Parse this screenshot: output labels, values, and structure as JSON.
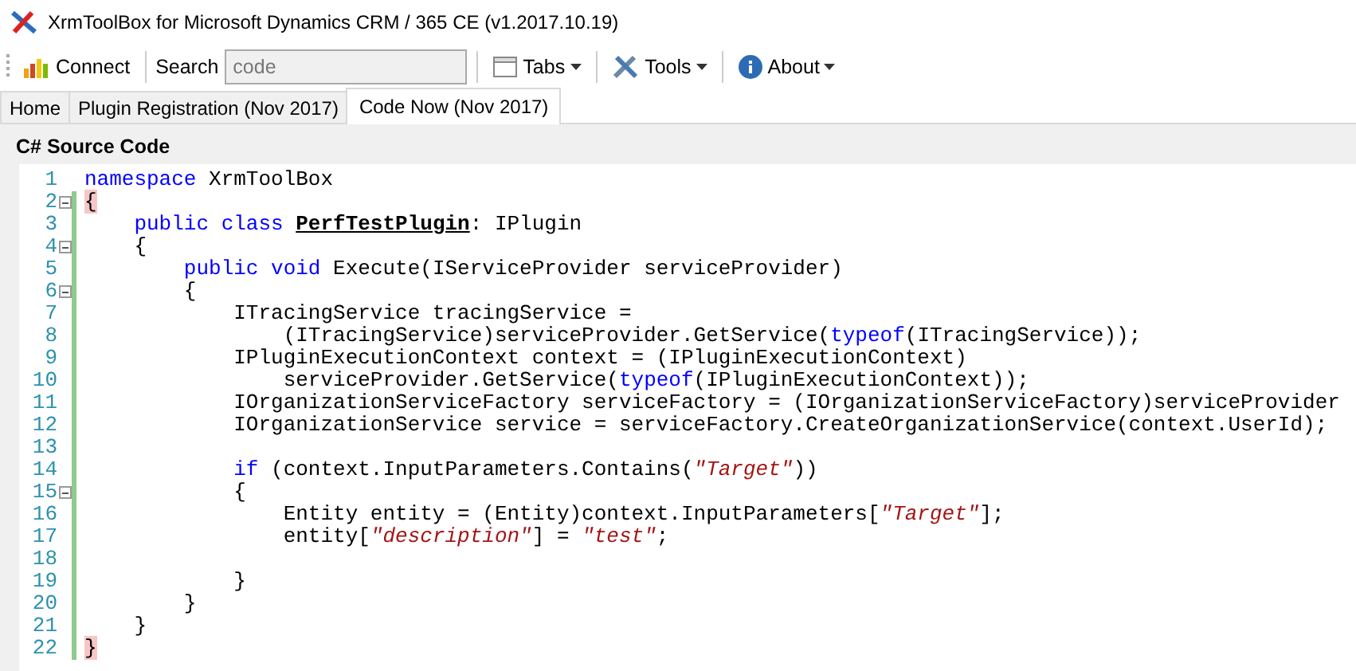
{
  "window": {
    "title": "XrmToolBox for Microsoft Dynamics CRM / 365 CE (v1.2017.10.19)"
  },
  "toolbar": [
    {
      "kind": "button",
      "label": "Connect"
    },
    {
      "kind": "label",
      "label": "Search"
    },
    {
      "kind": "field",
      "value": "code"
    },
    {
      "kind": "menu",
      "label": "Tabs"
    },
    {
      "kind": "menu",
      "label": "Tools"
    },
    {
      "kind": "menu",
      "label": "About"
    }
  ],
  "tabs": [
    {
      "label": "Home",
      "selected": false
    },
    {
      "label": "Plugin Registration (Nov 2017)",
      "selected": false
    },
    {
      "label": "Code Now (Nov 2017)",
      "selected": true
    }
  ],
  "panel": {
    "title": "C# Source Code"
  },
  "editor": {
    "lines": [
      {
        "number": "1",
        "fold": false,
        "changed": false,
        "tokens": [
          {
            "kind": "keyword",
            "text": "namespace"
          },
          {
            "kind": "plain",
            "text": " XrmToolBox"
          }
        ]
      },
      {
        "number": "2",
        "fold": true,
        "changed": true,
        "tokens": [
          {
            "kind": "brace-match",
            "text": "{"
          }
        ]
      },
      {
        "number": "3",
        "fold": false,
        "changed": true,
        "tokens": [
          {
            "kind": "keyword",
            "text": "    public class "
          },
          {
            "kind": "declaration",
            "text": "PerfTestPlugin"
          },
          {
            "kind": "plain",
            "text": ": IPlugin"
          }
        ]
      },
      {
        "number": "4",
        "fold": true,
        "changed": true,
        "tokens": [
          {
            "kind": "plain",
            "text": "    {"
          }
        ]
      },
      {
        "number": "5",
        "fold": false,
        "changed": true,
        "tokens": [
          {
            "kind": "keyword",
            "text": "        public void"
          },
          {
            "kind": "plain",
            "text": " Execute(IServiceProvider serviceProvider)"
          }
        ]
      },
      {
        "number": "6",
        "fold": true,
        "changed": true,
        "tokens": [
          {
            "kind": "plain",
            "text": "        {"
          }
        ]
      },
      {
        "number": "7",
        "fold": false,
        "changed": true,
        "tokens": [
          {
            "kind": "plain",
            "text": "            ITracingService tracingService ="
          }
        ]
      },
      {
        "number": "8",
        "fold": false,
        "changed": true,
        "tokens": [
          {
            "kind": "plain",
            "text": "                (ITracingService)serviceProvider.GetService("
          },
          {
            "kind": "keyword",
            "text": "typeof"
          },
          {
            "kind": "plain",
            "text": "(ITracingService));"
          }
        ]
      },
      {
        "number": "9",
        "fold": false,
        "changed": true,
        "tokens": [
          {
            "kind": "plain",
            "text": "            IPluginExecutionContext context = (IPluginExecutionContext)"
          }
        ]
      },
      {
        "number": "10",
        "fold": false,
        "changed": true,
        "tokens": [
          {
            "kind": "plain",
            "text": "                serviceProvider.GetService("
          },
          {
            "kind": "keyword",
            "text": "typeof"
          },
          {
            "kind": "plain",
            "text": "(IPluginExecutionContext));"
          }
        ]
      },
      {
        "number": "11",
        "fold": false,
        "changed": true,
        "tokens": [
          {
            "kind": "plain",
            "text": "            IOrganizationServiceFactory serviceFactory = (IOrganizationServiceFactory)serviceProvider"
          }
        ]
      },
      {
        "number": "12",
        "fold": false,
        "changed": true,
        "tokens": [
          {
            "kind": "plain",
            "text": "            IOrganizationService service = serviceFactory.CreateOrganizationService(context.UserId);"
          }
        ]
      },
      {
        "number": "13",
        "fold": false,
        "changed": true
      },
      {
        "number": "14",
        "fold": false,
        "changed": true,
        "tokens": [
          {
            "kind": "keyword",
            "text": "            if"
          },
          {
            "kind": "plain",
            "text": " (context.InputParameters.Contains("
          },
          {
            "kind": "string",
            "text": "\"Target\""
          },
          {
            "kind": "plain",
            "text": "))"
          }
        ]
      },
      {
        "number": "15",
        "fold": true,
        "changed": true,
        "tokens": [
          {
            "kind": "plain",
            "text": "            {"
          }
        ]
      },
      {
        "number": "16",
        "fold": false,
        "changed": true,
        "tokens": [
          {
            "kind": "plain",
            "text": "                Entity entity = (Entity)context.InputParameters["
          },
          {
            "kind": "string",
            "text": "\"Target\""
          },
          {
            "kind": "plain",
            "text": "];"
          }
        ]
      },
      {
        "number": "17",
        "fold": false,
        "changed": true,
        "tokens": [
          {
            "kind": "plain",
            "text": "                entity["
          },
          {
            "kind": "string",
            "text": "\"description\""
          },
          {
            "kind": "plain",
            "text": "] = "
          },
          {
            "kind": "string",
            "text": "\"test\""
          },
          {
            "kind": "plain",
            "text": ";"
          }
        ]
      },
      {
        "number": "18",
        "fold": false,
        "changed": true
      },
      {
        "number": "19",
        "fold": false,
        "changed": true,
        "tokens": [
          {
            "kind": "plain",
            "text": "            }"
          }
        ]
      },
      {
        "number": "20",
        "fold": false,
        "changed": true,
        "tokens": [
          {
            "kind": "plain",
            "text": "        }"
          }
        ]
      },
      {
        "number": "21",
        "fold": false,
        "changed": true,
        "tokens": [
          {
            "kind": "plain",
            "text": "    }"
          }
        ]
      },
      {
        "number": "22",
        "fold": false,
        "changed": true,
        "tokens": [
          {
            "kind": "brace-match",
            "text": "}"
          }
        ]
      }
    ]
  }
}
